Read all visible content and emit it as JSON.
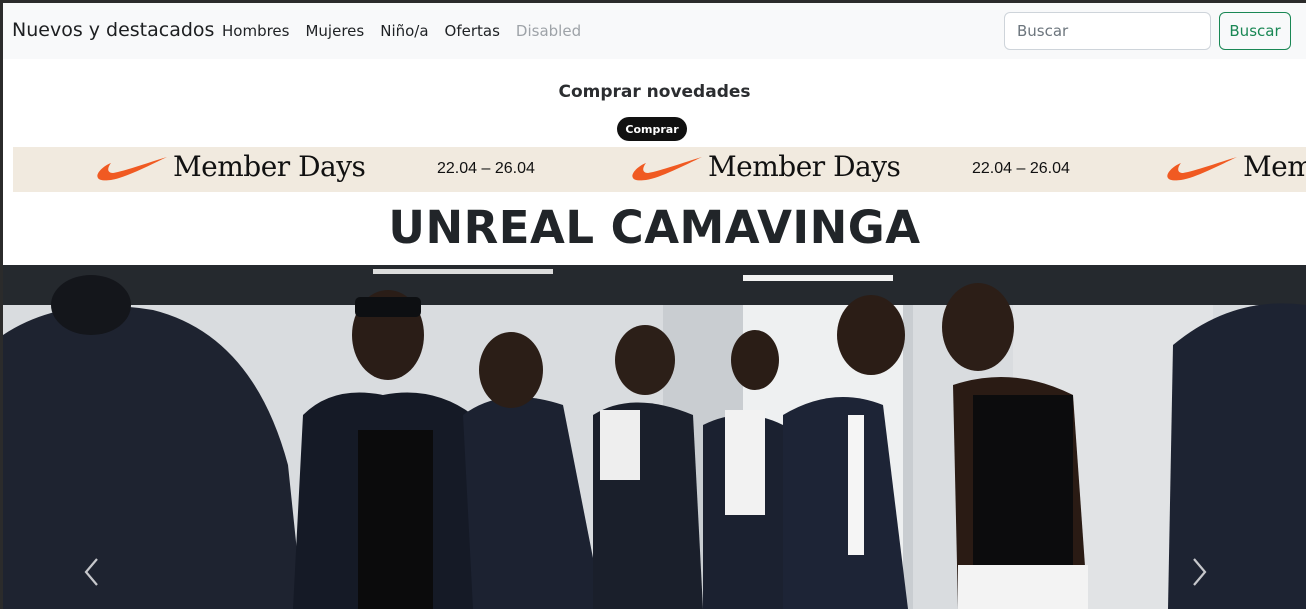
{
  "navbar": {
    "brand": "Nuevos y destacados",
    "links": [
      {
        "label": "Hombres"
      },
      {
        "label": "Mujeres"
      },
      {
        "label": "Niño/a"
      },
      {
        "label": "Ofertas"
      },
      {
        "label": "Disabled",
        "disabled": true
      }
    ],
    "search": {
      "placeholder": "Buscar",
      "value": "",
      "button_label": "Buscar"
    }
  },
  "hero": {
    "headline": "Comprar novedades",
    "button_label": "Comprar"
  },
  "banner": {
    "title": "Member Days",
    "dates": "22.04 – 26.04",
    "logo_icon": "nike-swoosh-icon",
    "colors": {
      "background": "#f1eadf",
      "swoosh": "#f05a22"
    }
  },
  "feature": {
    "title": "UNREAL CAMAVINGA"
  },
  "carousel": {
    "prev_icon": "chevron-left-icon",
    "next_icon": "chevron-right-icon"
  },
  "colors": {
    "accent": "#198754",
    "navbar_bg": "#f8f9fa"
  }
}
